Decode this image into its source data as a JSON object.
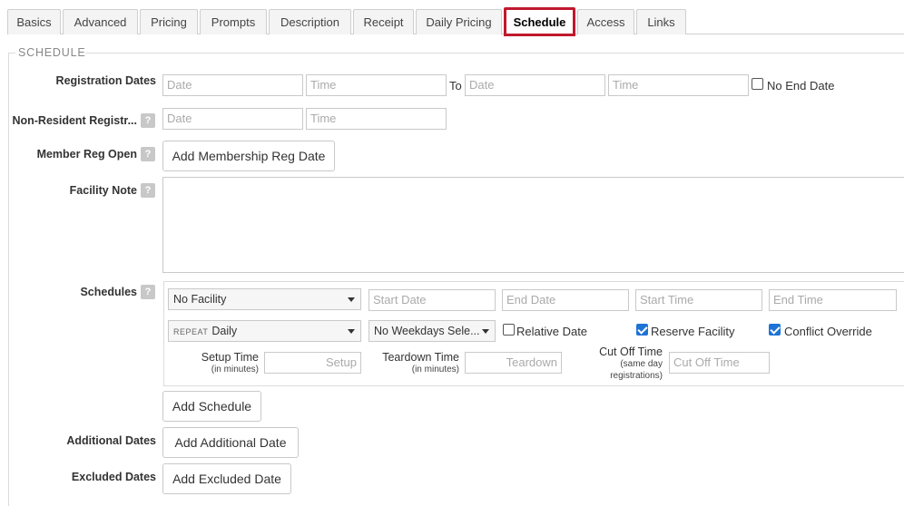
{
  "tabs": [
    {
      "label": "Basics"
    },
    {
      "label": "Advanced"
    },
    {
      "label": "Pricing"
    },
    {
      "label": "Prompts"
    },
    {
      "label": "Description"
    },
    {
      "label": "Receipt"
    },
    {
      "label": "Daily Pricing"
    },
    {
      "label": "Schedule"
    },
    {
      "label": "Access"
    },
    {
      "label": "Links"
    }
  ],
  "active_tab": "Schedule",
  "accent_color": "#c0182d",
  "section_title": "SCHEDULE",
  "registration": {
    "label": "Registration Dates",
    "start_date_placeholder": "Date",
    "start_time_placeholder": "Time",
    "to_label": "To",
    "end_date_placeholder": "Date",
    "end_time_placeholder": "Time",
    "no_end_date_label": "No End Date"
  },
  "non_resident": {
    "label": "Non-Resident Registr...",
    "date_placeholder": "Date",
    "time_placeholder": "Time"
  },
  "member_reg": {
    "label": "Member Reg Open",
    "button": "Add Membership Reg Date"
  },
  "facility_note": {
    "label": "Facility Note"
  },
  "help_glyph": "?",
  "schedules": {
    "label": "Schedules",
    "facility_select": "No Facility",
    "start_date_placeholder": "Start Date",
    "end_date_placeholder": "End Date",
    "start_time_placeholder": "Start Time",
    "end_time_placeholder": "End Time",
    "repeat_prefix": "REPEAT",
    "repeat_value": "Daily",
    "weekdays_value": "No Weekdays Sele...",
    "relative_date_label": "Relative Date",
    "reserve_facility_label": "Reserve Facility",
    "conflict_override_label": "Conflict Override",
    "relative_date_checked": false,
    "reserve_facility_checked": true,
    "conflict_override_checked": true,
    "setup_label": "Setup Time",
    "setup_sub": "(in minutes)",
    "setup_placeholder": "Setup",
    "teardown_label": "Teardown Time",
    "teardown_sub": "(in minutes)",
    "teardown_placeholder": "Teardown",
    "cutoff_label": "Cut Off Time",
    "cutoff_sub1": "(same day",
    "cutoff_sub2": "registrations)",
    "cutoff_placeholder": "Cut Off Time",
    "add_button": "Add Schedule"
  },
  "additional_dates": {
    "label": "Additional Dates",
    "button": "Add Additional Date"
  },
  "excluded_dates": {
    "label": "Excluded Dates",
    "button": "Add Excluded Date"
  }
}
